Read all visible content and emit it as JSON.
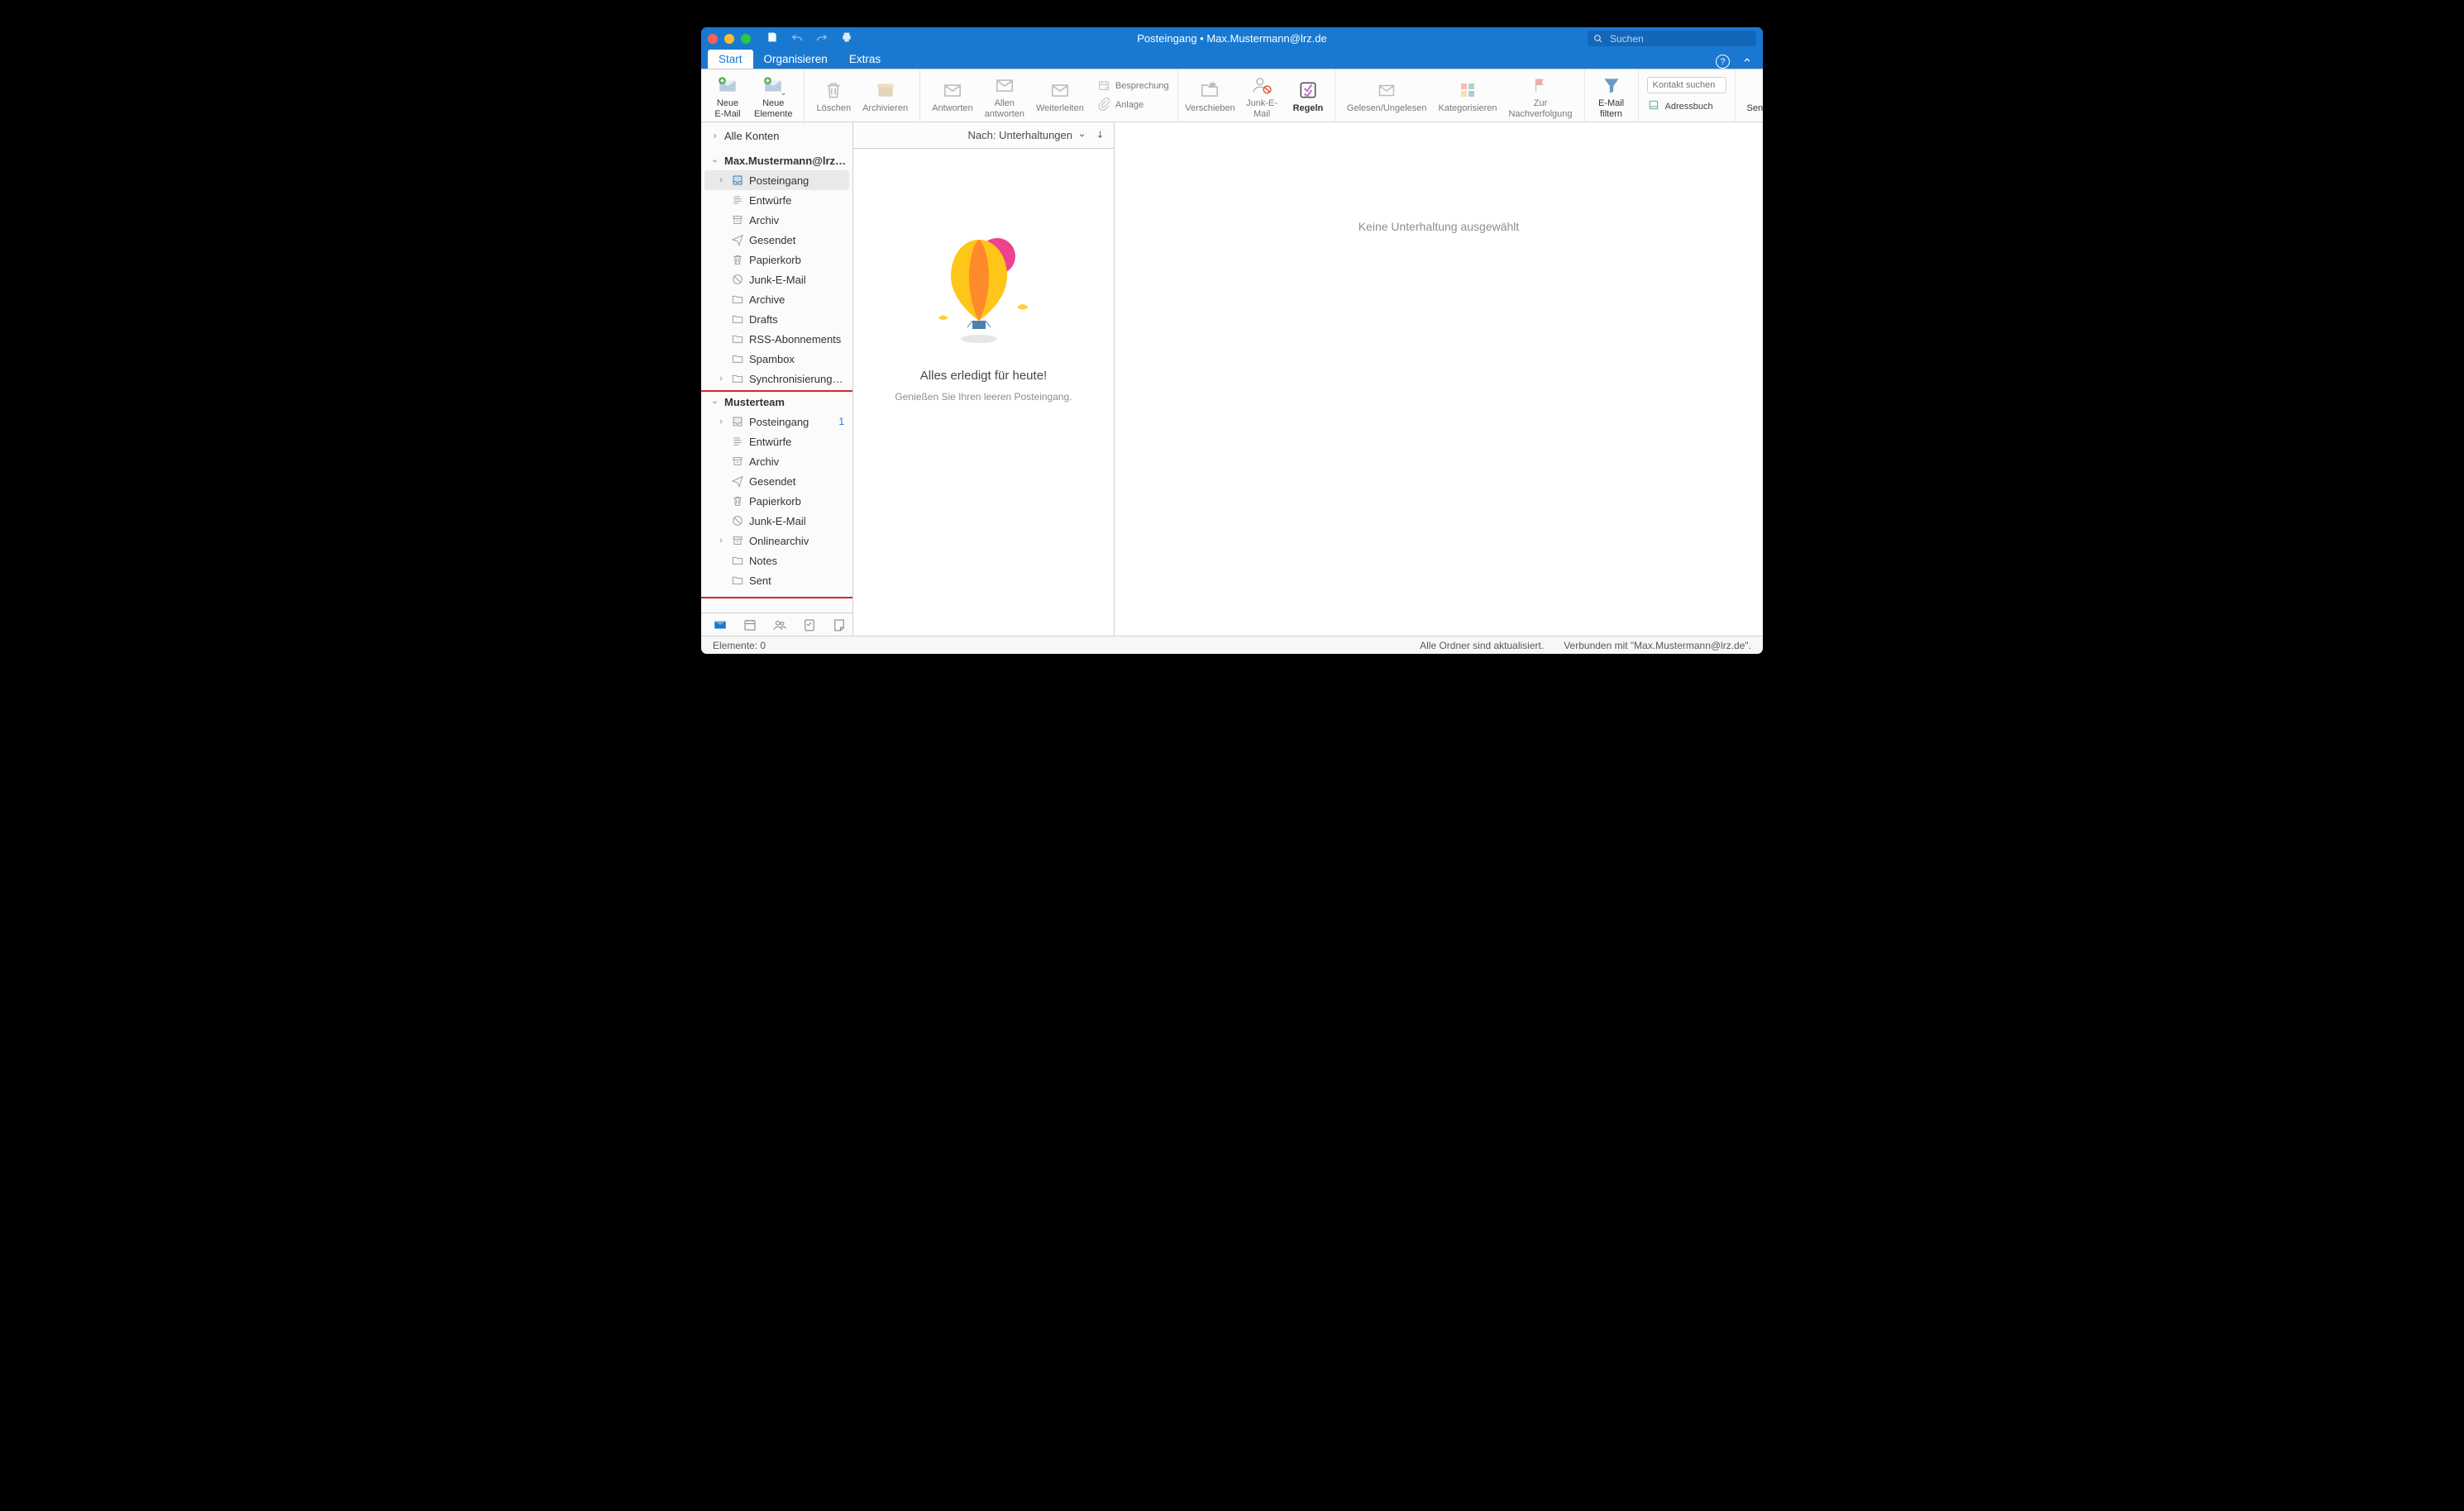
{
  "window": {
    "title": "Posteingang • Max.Mustermann@lrz.de"
  },
  "qat": {
    "save": "save-icon",
    "undo": "undo-icon",
    "redo": "redo-icon",
    "print": "print-icon"
  },
  "search": {
    "placeholder": "Suchen"
  },
  "tabs": [
    {
      "id": "start",
      "label": "Start",
      "active": true
    },
    {
      "id": "organize",
      "label": "Organisieren",
      "active": false
    },
    {
      "id": "extras",
      "label": "Extras",
      "active": false
    }
  ],
  "ribbon": {
    "new_mail": "Neue\nE-Mail",
    "new_elements": "Neue\nElemente",
    "delete": "Löschen",
    "archive_btn": "Archivieren",
    "reply": "Antworten",
    "reply_all": "Allen\nantworten",
    "forward": "Weiterleiten",
    "meeting": "Besprechung",
    "attachment": "Anlage",
    "move": "Verschieben",
    "junk": "Junk-E-Mail",
    "rules": "Regeln",
    "read_unread": "Gelesen/Ungelesen",
    "categorize": "Kategorisieren",
    "follow_up": "Zur\nNachverfolgung",
    "filter": "E-Mail\nfiltern",
    "contact_search_placeholder": "Kontakt suchen",
    "address_book": "Adressbuch",
    "send_receive": "Senden/Empfangen"
  },
  "sidebar": {
    "all_accounts": "Alle Konten",
    "accounts": [
      {
        "name": "Max.Mustermann@lrz.de",
        "folders": [
          {
            "id": "inbox",
            "label": "Posteingang",
            "icon": "inbox-icon",
            "selected": true,
            "chevron": "right"
          },
          {
            "id": "drafts",
            "label": "Entwürfe",
            "icon": "drafts-icon"
          },
          {
            "id": "archive",
            "label": "Archiv",
            "icon": "archive-icon"
          },
          {
            "id": "sent",
            "label": "Gesendet",
            "icon": "sent-icon"
          },
          {
            "id": "trash",
            "label": "Papierkorb",
            "icon": "trash-icon"
          },
          {
            "id": "junk",
            "label": "Junk-E-Mail",
            "icon": "junk-icon"
          },
          {
            "id": "archive2",
            "label": "Archive",
            "icon": "folder-icon"
          },
          {
            "id": "drafts2",
            "label": "Drafts",
            "icon": "folder-icon"
          },
          {
            "id": "rss",
            "label": "RSS-Abonnements",
            "icon": "folder-icon"
          },
          {
            "id": "spambox",
            "label": "Spambox",
            "icon": "folder-icon"
          },
          {
            "id": "sync",
            "label": "Synchronisierungspro…",
            "icon": "folder-icon",
            "chevron": "right"
          }
        ]
      },
      {
        "name": "Musterteam",
        "highlighted": true,
        "folders": [
          {
            "id": "t_inbox",
            "label": "Posteingang",
            "icon": "inbox-icon",
            "chevron": "right",
            "badge": "1"
          },
          {
            "id": "t_drafts",
            "label": "Entwürfe",
            "icon": "drafts-icon"
          },
          {
            "id": "t_archive",
            "label": "Archiv",
            "icon": "archive-icon"
          },
          {
            "id": "t_sent",
            "label": "Gesendet",
            "icon": "sent-icon"
          },
          {
            "id": "t_trash",
            "label": "Papierkorb",
            "icon": "trash-icon"
          },
          {
            "id": "t_junk",
            "label": "Junk-E-Mail",
            "icon": "junk-icon"
          },
          {
            "id": "t_online",
            "label": "Onlinearchiv",
            "icon": "archive-icon",
            "chevron": "right"
          },
          {
            "id": "t_notes",
            "label": "Notes",
            "icon": "folder-icon"
          },
          {
            "id": "t_sent2",
            "label": "Sent",
            "icon": "folder-icon"
          }
        ]
      }
    ]
  },
  "listpane": {
    "sort_label": "Nach: Unterhaltungen",
    "empty_title": "Alles erledigt für heute!",
    "empty_sub": "Genießen Sie Ihren leeren Posteingang."
  },
  "reading": {
    "placeholder": "Keine Unterhaltung ausgewählt"
  },
  "status": {
    "left": "Elemente: 0",
    "right1": "Alle Ordner sind aktualisiert.",
    "right2": "Verbunden mit \"Max.Mustermann@lrz.de\"."
  }
}
